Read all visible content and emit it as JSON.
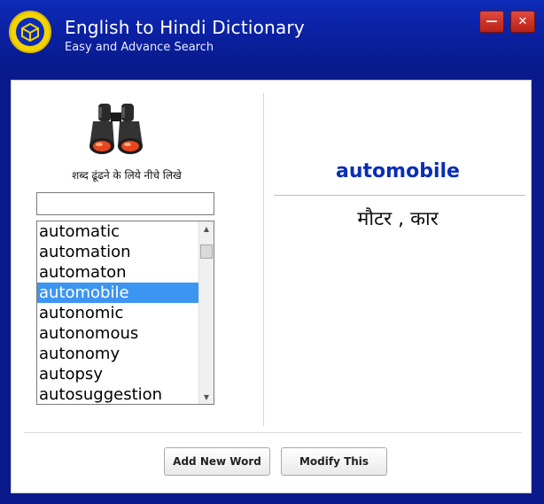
{
  "window": {
    "title": "English to Hindi Dictionary",
    "subtitle": "Easy and Advance Search",
    "minimize_glyph": "—",
    "close_glyph": "✕"
  },
  "search": {
    "hint": "शब्द ढूंढने के लिये नीचे लिखे",
    "value": "",
    "placeholder": ""
  },
  "word_list": {
    "items": [
      "automatic",
      "automation",
      "automaton",
      "automobile",
      "autonomic",
      "autonomous",
      "autonomy",
      "autopsy",
      "autosuggestion"
    ],
    "selected_index": 3,
    "up_arrow": "▲",
    "down_arrow": "▼"
  },
  "result": {
    "word": "automobile",
    "meaning": "मौटर , कार"
  },
  "buttons": {
    "add_label": "Add New Word",
    "modify_label": "Modify This"
  },
  "colors": {
    "titlebar": "#0a1f9e",
    "accent_word": "#0a2db5",
    "selection": "#3d95f2",
    "close_button": "#c7281c"
  }
}
